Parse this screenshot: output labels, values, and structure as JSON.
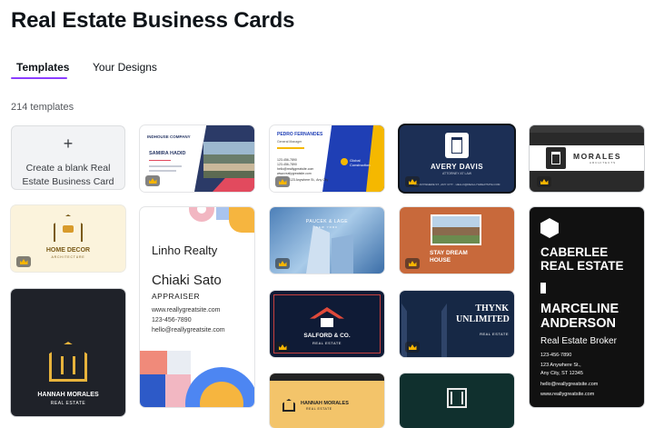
{
  "page": {
    "title": "Real Estate Business Cards"
  },
  "tabs": [
    {
      "label": "Templates"
    },
    {
      "label": "Your Designs"
    }
  ],
  "results": {
    "count_text": "214 templates"
  },
  "blank_card": {
    "plus": "+",
    "label": "Create a blank Real Estate Business Card"
  },
  "colors": {
    "accent": "#8b3dff",
    "crown": "#f7b500"
  },
  "cards": {
    "indhouse": {
      "company": "INDHOUSE COMPANY",
      "name": "SAMIRA HADID"
    },
    "pedro": {
      "name": "PEDRO FERNANDES",
      "role": "General Manager",
      "phone1": "123-456-7890",
      "phone2": "123-456-7890",
      "email": "hello@reallygreatsite.com",
      "web": "www.reallygreatsite.com",
      "address": "123 Anywhere St., Any City",
      "brand": "Global Construction"
    },
    "avery": {
      "name": "AVERY DAVIS",
      "role": "ATTORNEY AT LAW",
      "contact": "123 ANYWHERE ST., ANY CITY  ·  HELLO@REALLYGREATSITE.COM"
    },
    "morales": {
      "name": "MORALES",
      "sub": "ARCHITECTS"
    },
    "homedecor": {
      "name": "HOME DECOR",
      "sub": "ARCHITECTURE"
    },
    "linho": {
      "brand": "Linho Realty",
      "name": "Chiaki Sato",
      "role": "APPRAISER",
      "web": "www.reallygreatsite.com",
      "phone": "123-456-7890",
      "email": "hello@reallygreatsite.com"
    },
    "paucek": {
      "name": "PAUCEK & LAGE",
      "sub": "NEW YORK"
    },
    "stay": {
      "line1": "STAY DREAM",
      "line2": "HOUSE"
    },
    "caberlee": {
      "company_line1": "CABERLEE",
      "company_line2": "REAL ESTATE",
      "name_line1": "MARCELINE",
      "name_line2": "ANDERSON",
      "role": "Real Estate Broker",
      "phone": "123-456-7890",
      "address1": "123 Anywhere St.,",
      "address2": "Any City, ST 12345",
      "email": "hello@reallygreatsite.com",
      "web": "www.reallygreatsite.com"
    },
    "hannah": {
      "name": "HANNAH MORALES",
      "sub": "REAL ESTATE"
    },
    "salford": {
      "name": "SALFORD & CO.",
      "sub": "REAL ESTATE"
    },
    "thynk": {
      "line1": "THYNK",
      "line2": "UNLIMITED",
      "sub": "REAL ESTATE"
    },
    "hannah2": {
      "name": "HANNAH MORALES",
      "sub": "REAL ESTATE"
    }
  }
}
